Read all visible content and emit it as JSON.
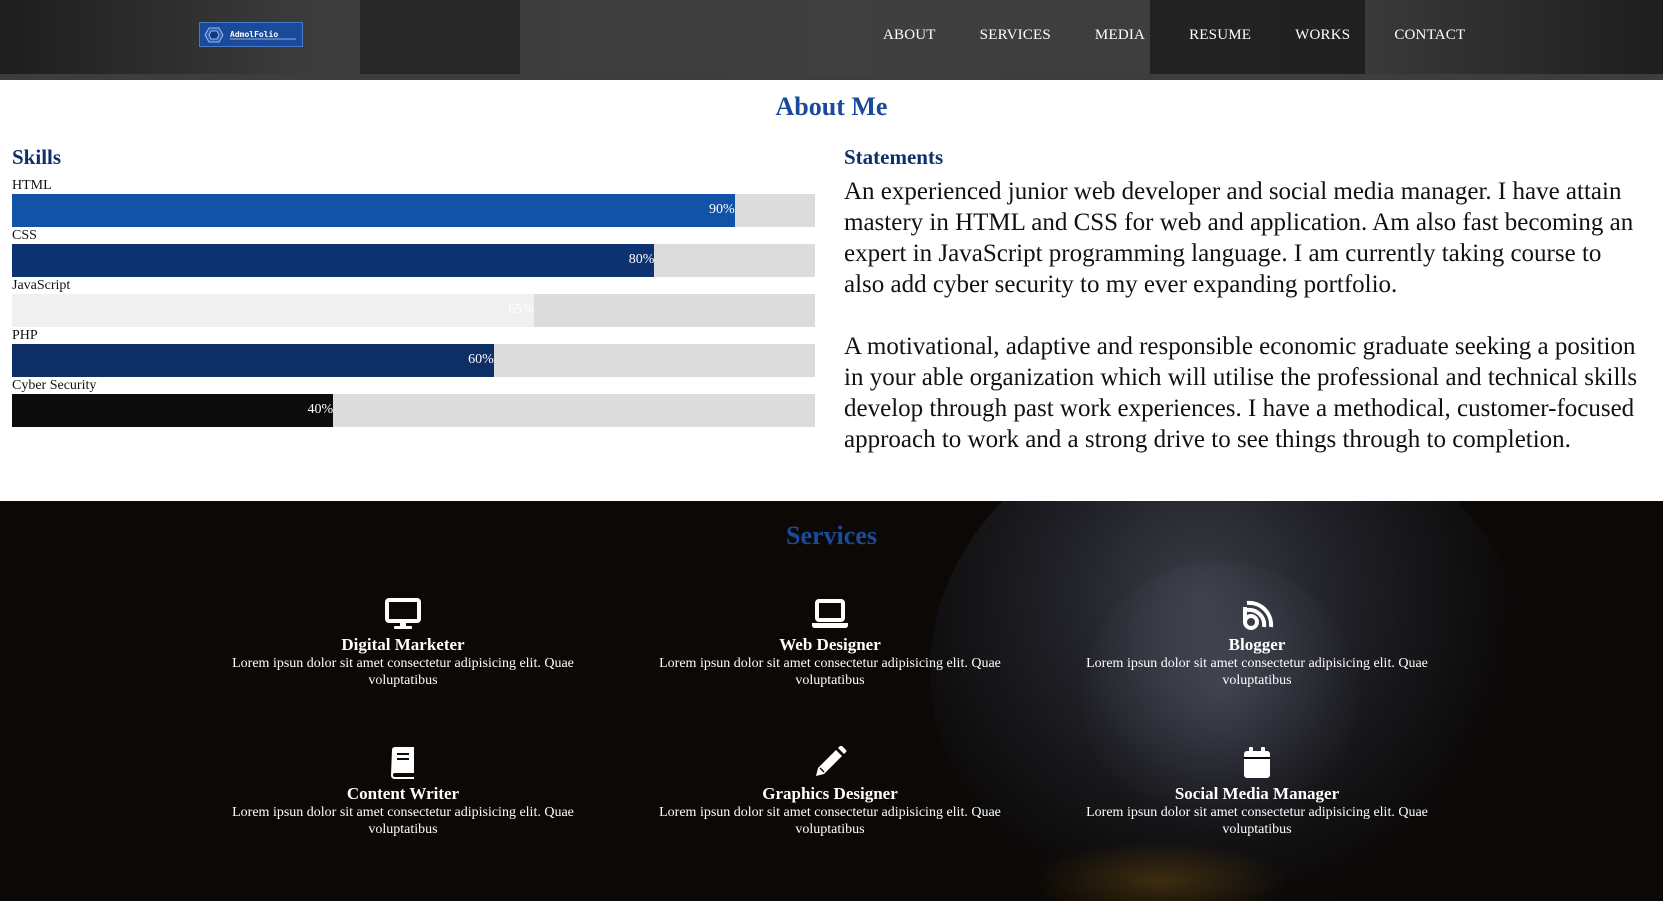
{
  "nav": {
    "logo_text": "AdmolFolio",
    "items": [
      {
        "label": "ABOUT"
      },
      {
        "label": "SERVICES"
      },
      {
        "label": "MEDIA"
      },
      {
        "label": "RESUME"
      },
      {
        "label": "WORKS"
      },
      {
        "label": "CONTACT"
      }
    ]
  },
  "about": {
    "title": "About Me",
    "skills_title": "Skills",
    "skills": [
      {
        "label": "HTML",
        "percent": 90,
        "percent_text": "90%",
        "color": "#1253a8"
      },
      {
        "label": "CSS",
        "percent": 80,
        "percent_text": "80%",
        "color": "#0d3272"
      },
      {
        "label": "JavaScript",
        "percent": 65,
        "percent_text": "65%",
        "color": "#f0f0f0"
      },
      {
        "label": "PHP",
        "percent": 60,
        "percent_text": "60%",
        "color": "#0d2f66"
      },
      {
        "label": "Cyber Security",
        "percent": 40,
        "percent_text": "40%",
        "color": "#0c0c0c"
      }
    ],
    "statements_title": "Statements",
    "statement_1": "An experienced junior web developer and social media manager. I have attain mastery in HTML and CSS for web and application. Am also fast becoming an expert in JavaScript programming language. I am currently taking course to also add cyber security to my ever expanding portfolio.",
    "statement_2": "A motivational, adaptive and responsible economic graduate seeking a position in your able organization which will utilise the professional and technical skills develop through past work experiences. I have a methodical, customer-focused approach to work and a strong drive to see things through to completion."
  },
  "services": {
    "title": "Services",
    "items": [
      {
        "name": "Digital Marketer",
        "icon": "desktop-icon",
        "desc": "Lorem ipsun dolor sit amet consectetur adipisicing elit. Quae voluptatibus"
      },
      {
        "name": "Web Designer",
        "icon": "laptop-icon",
        "desc": "Lorem ipsun dolor sit amet consectetur adipisicing elit. Quae voluptatibus"
      },
      {
        "name": "Blogger",
        "icon": "blog-icon",
        "desc": "Lorem ipsun dolor sit amet consectetur adipisicing elit. Quae voluptatibus"
      },
      {
        "name": "Content Writer",
        "icon": "book-icon",
        "desc": "Lorem ipsun dolor sit amet consectetur adipisicing elit. Quae voluptatibus"
      },
      {
        "name": "Graphics Designer",
        "icon": "pencil-icon",
        "desc": "Lorem ipsun dolor sit amet consectetur adipisicing elit. Quae voluptatibus"
      },
      {
        "name": "Social Media Manager",
        "icon": "calendar-icon",
        "desc": "Lorem ipsun dolor sit amet consectetur adipisicing elit. Quae voluptatibus"
      }
    ]
  },
  "colors": {
    "accent_blue": "#1a4a9a",
    "heading_navy": "#0d2f6b",
    "track_gray": "#dcdcdc"
  }
}
